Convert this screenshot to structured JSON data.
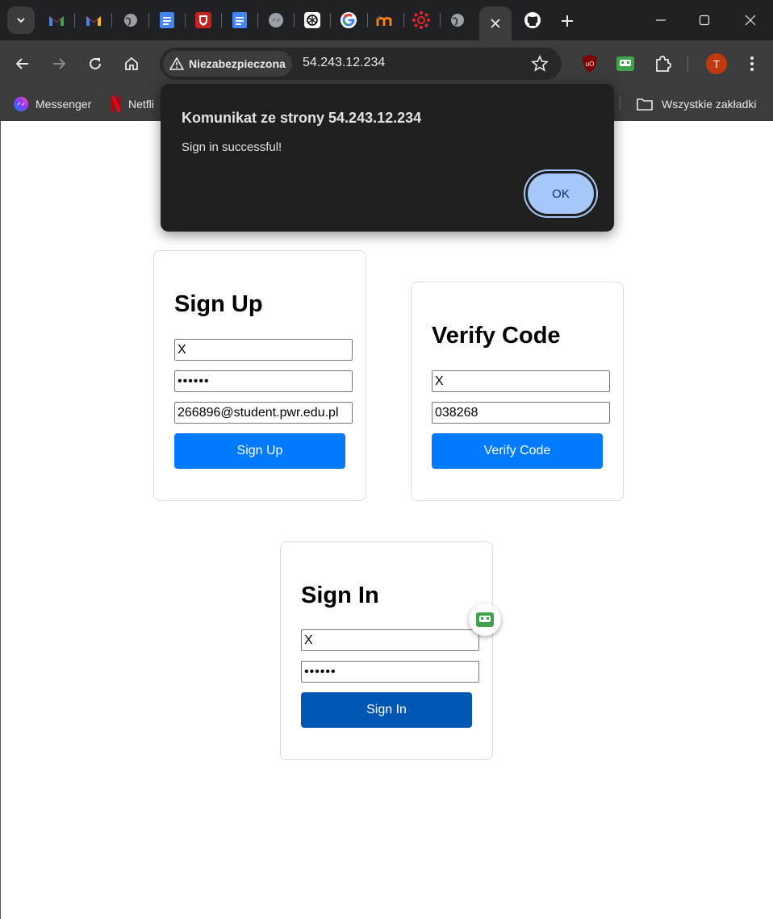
{
  "browser": {
    "security_label": "Niezabezpieczona",
    "url": "54.243.12.234",
    "profile_initial": "T",
    "bookmarks": [
      {
        "label": "Messenger"
      },
      {
        "label": "Netfli"
      },
      {
        "label": "Wszystkie zakładki"
      }
    ]
  },
  "dialog": {
    "title": "Komunikat ze strony 54.243.12.234",
    "message": "Sign in successful!",
    "ok_label": "OK"
  },
  "signup": {
    "heading": "Sign Up",
    "username": "X",
    "password": "••••••",
    "email": "266896@student.pwr.edu.pl",
    "button_label": "Sign Up"
  },
  "verify": {
    "heading": "Verify Code",
    "username": "X",
    "code": "038268",
    "button_label": "Verify Code"
  },
  "signin": {
    "heading": "Sign In",
    "username": "X",
    "password": "••••••",
    "button_label": "Sign In"
  },
  "colors": {
    "primary_button": "#007bff",
    "signin_button": "#0056b3",
    "dialog_ok": "#a8c7fa"
  }
}
